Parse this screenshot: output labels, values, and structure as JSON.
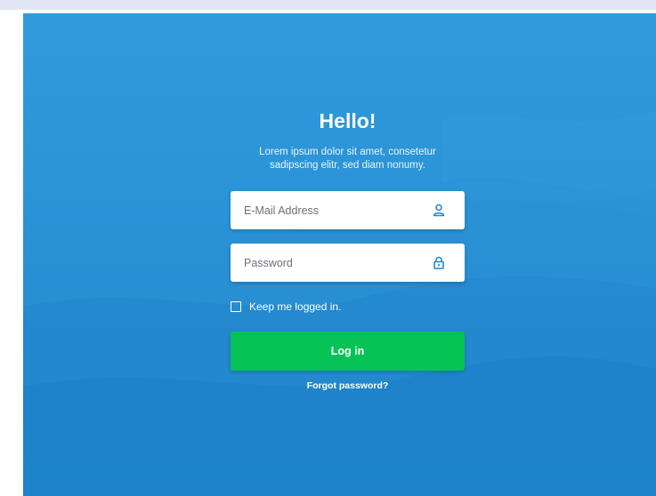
{
  "page": {
    "title": "Hello!",
    "subtitle_line1": "Lorem ipsum dolor sit amet, consetetur",
    "subtitle_line2": "sadipscing elitr, sed diam nonumy."
  },
  "form": {
    "email": {
      "placeholder": "E-Mail Address",
      "value": "",
      "icon": "user-icon"
    },
    "password": {
      "placeholder": "Password",
      "value": "",
      "icon": "lock-icon"
    },
    "remember": {
      "label": "Keep me logged in.",
      "checked": false
    },
    "submit_label": "Log in",
    "forgot_label": "Forgot password?"
  },
  "colors": {
    "background": "#2a93d6",
    "accent_icon": "#1f8ad0",
    "button": "#05c355",
    "top_strip": "#e3e6f4"
  }
}
